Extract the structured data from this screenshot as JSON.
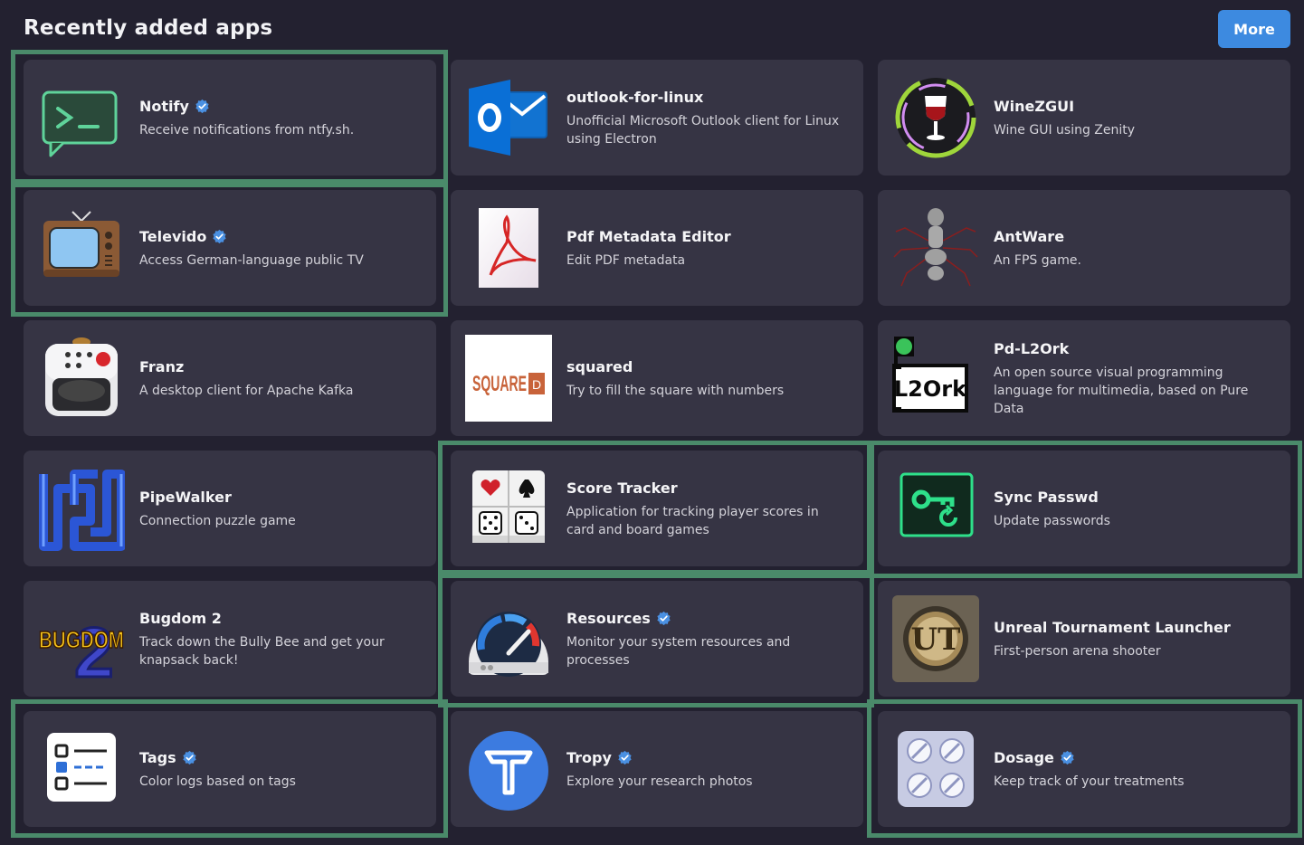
{
  "section": {
    "title": "Recently added apps",
    "more_label": "More"
  },
  "colors": {
    "background": "#232130",
    "card": "#363444",
    "accent": "#3d8ae0",
    "highlight": "#4a8a6a"
  },
  "apps": [
    {
      "name": "Notify",
      "summary": "Receive notifications from ntfy.sh.",
      "verified": true,
      "icon": "terminal-chat-icon",
      "highlighted": true
    },
    {
      "name": "outlook-for-linux",
      "summary": "Unofficial Microsoft Outlook client for Linux using Electron",
      "verified": false,
      "icon": "outlook-icon",
      "highlighted": false
    },
    {
      "name": "WineZGUI",
      "summary": "Wine GUI using Zenity",
      "verified": false,
      "icon": "wine-glass-icon",
      "highlighted": false
    },
    {
      "name": "Televido",
      "summary": "Access German-language public TV",
      "verified": true,
      "icon": "retro-tv-icon",
      "highlighted": true
    },
    {
      "name": "Pdf Metadata Editor",
      "summary": "Edit PDF metadata",
      "verified": false,
      "icon": "pdf-document-icon",
      "highlighted": false
    },
    {
      "name": "AntWare",
      "summary": "An FPS game.",
      "verified": false,
      "icon": "ant-icon",
      "highlighted": false
    },
    {
      "name": "Franz",
      "summary": "A desktop client for Apache Kafka",
      "verified": false,
      "icon": "kafka-machine-icon",
      "highlighted": false
    },
    {
      "name": "squared",
      "summary": "Try to fill the square with numbers",
      "verified": false,
      "icon": "square-logo-icon",
      "highlighted": false,
      "icon_text": "SQUARE",
      "icon_badge": "D"
    },
    {
      "name": "Pd-L2Ork",
      "summary": "An open source visual programming language for multimedia, based on Pure Data",
      "verified": false,
      "icon": "l2ork-icon",
      "highlighted": false,
      "icon_text": "L2Ork"
    },
    {
      "name": "PipeWalker",
      "summary": "Connection puzzle game",
      "verified": false,
      "icon": "pipe-puzzle-icon",
      "highlighted": false
    },
    {
      "name": "Score Tracker",
      "summary": "Application for tracking player scores in card and board games",
      "verified": false,
      "icon": "card-dice-icon",
      "highlighted": true
    },
    {
      "name": "Sync Passwd",
      "summary": "Update passwords",
      "verified": false,
      "icon": "key-sync-icon",
      "highlighted": true
    },
    {
      "name": "Bugdom 2",
      "summary": "Track down the Bully Bee and get your knapsack back!",
      "verified": false,
      "icon": "bugdom-logo-icon",
      "highlighted": false,
      "icon_text": "BUGDOM",
      "icon_badge": "2"
    },
    {
      "name": "Resources",
      "summary": "Monitor your system resources and processes",
      "verified": true,
      "icon": "speedometer-icon",
      "highlighted": true
    },
    {
      "name": "Unreal Tournament Launcher",
      "summary": "First-person arena shooter",
      "verified": false,
      "icon": "unreal-tournament-icon",
      "highlighted": false,
      "icon_text": "UT"
    },
    {
      "name": "Tags",
      "summary": "Color logs based on tags",
      "verified": true,
      "icon": "checklist-icon",
      "highlighted": true
    },
    {
      "name": "Tropy",
      "summary": "Explore your research photos",
      "verified": true,
      "icon": "tropy-icon",
      "highlighted": false
    },
    {
      "name": "Dosage",
      "summary": "Keep track of your treatments",
      "verified": true,
      "icon": "pills-icon",
      "highlighted": true
    }
  ]
}
